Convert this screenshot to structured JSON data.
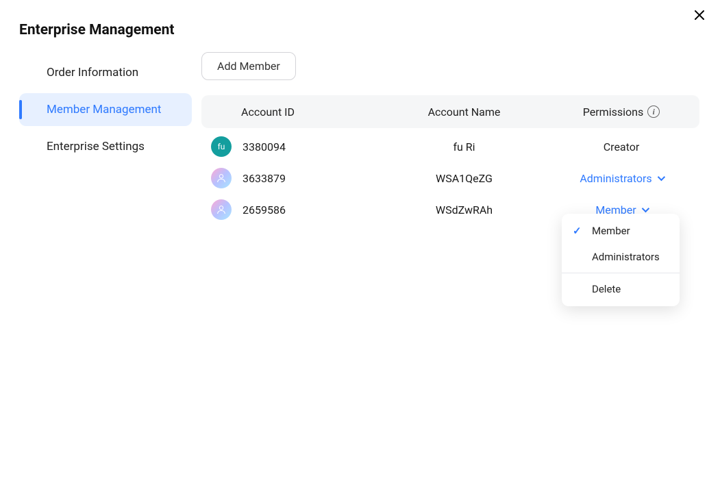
{
  "page": {
    "title": "Enterprise Management"
  },
  "sidebar": {
    "items": [
      {
        "label": "Order Information",
        "active": false
      },
      {
        "label": "Member Management",
        "active": true
      },
      {
        "label": "Enterprise Settings",
        "active": false
      }
    ]
  },
  "actions": {
    "add_member": "Add Member"
  },
  "table": {
    "headers": {
      "account_id": "Account ID",
      "account_name": "Account Name",
      "permissions": "Permissions"
    },
    "rows": [
      {
        "avatar_text": "fu",
        "avatar_style": "teal",
        "account_id": "3380094",
        "account_name": "fu Ri",
        "permission": "Creator",
        "permission_editable": false
      },
      {
        "avatar_text": "",
        "avatar_style": "gradient",
        "account_id": "3633879",
        "account_name": "WSA1QeZG",
        "permission": "Administrators",
        "permission_editable": true
      },
      {
        "avatar_text": "",
        "avatar_style": "gradient",
        "account_id": "2659586",
        "account_name": "WSdZwRAh",
        "permission": "Member",
        "permission_editable": true
      }
    ]
  },
  "dropdown": {
    "options": [
      {
        "label": "Member",
        "selected": true
      },
      {
        "label": "Administrators",
        "selected": false
      }
    ],
    "delete": "Delete"
  }
}
